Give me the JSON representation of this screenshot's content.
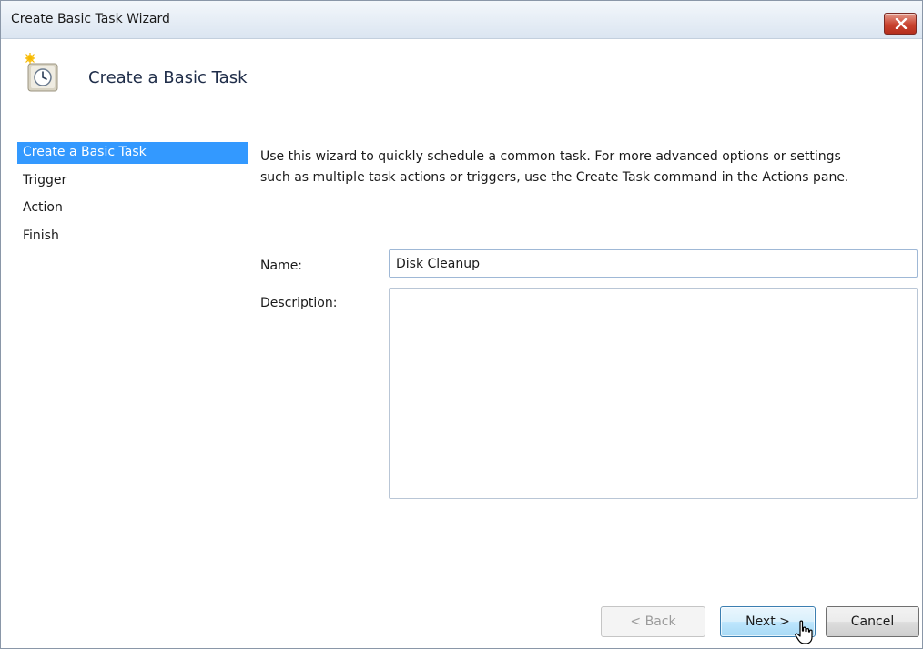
{
  "window": {
    "title": "Create Basic Task Wizard"
  },
  "header": {
    "title": "Create a Basic Task",
    "icon": "task-scheduler-clock-icon"
  },
  "nav": {
    "items": [
      {
        "label": "Create a Basic Task",
        "active": true
      },
      {
        "label": "Trigger",
        "active": false
      },
      {
        "label": "Action",
        "active": false
      },
      {
        "label": "Finish",
        "active": false
      }
    ]
  },
  "content": {
    "intro_line1": "Use this wizard to quickly schedule a common task.  For more advanced options or settings",
    "intro_line2": "such as multiple task actions or triggers, use the Create Task command in the Actions pane.",
    "name_label": "Name:",
    "name_value": "Disk Cleanup",
    "description_label": "Description:",
    "description_value": ""
  },
  "buttons": {
    "back": "< Back",
    "next": "Next >",
    "cancel": "Cancel"
  },
  "colors": {
    "selection": "#3399ff",
    "close_button": "#c9432f",
    "header_title": "#1f2d49"
  }
}
